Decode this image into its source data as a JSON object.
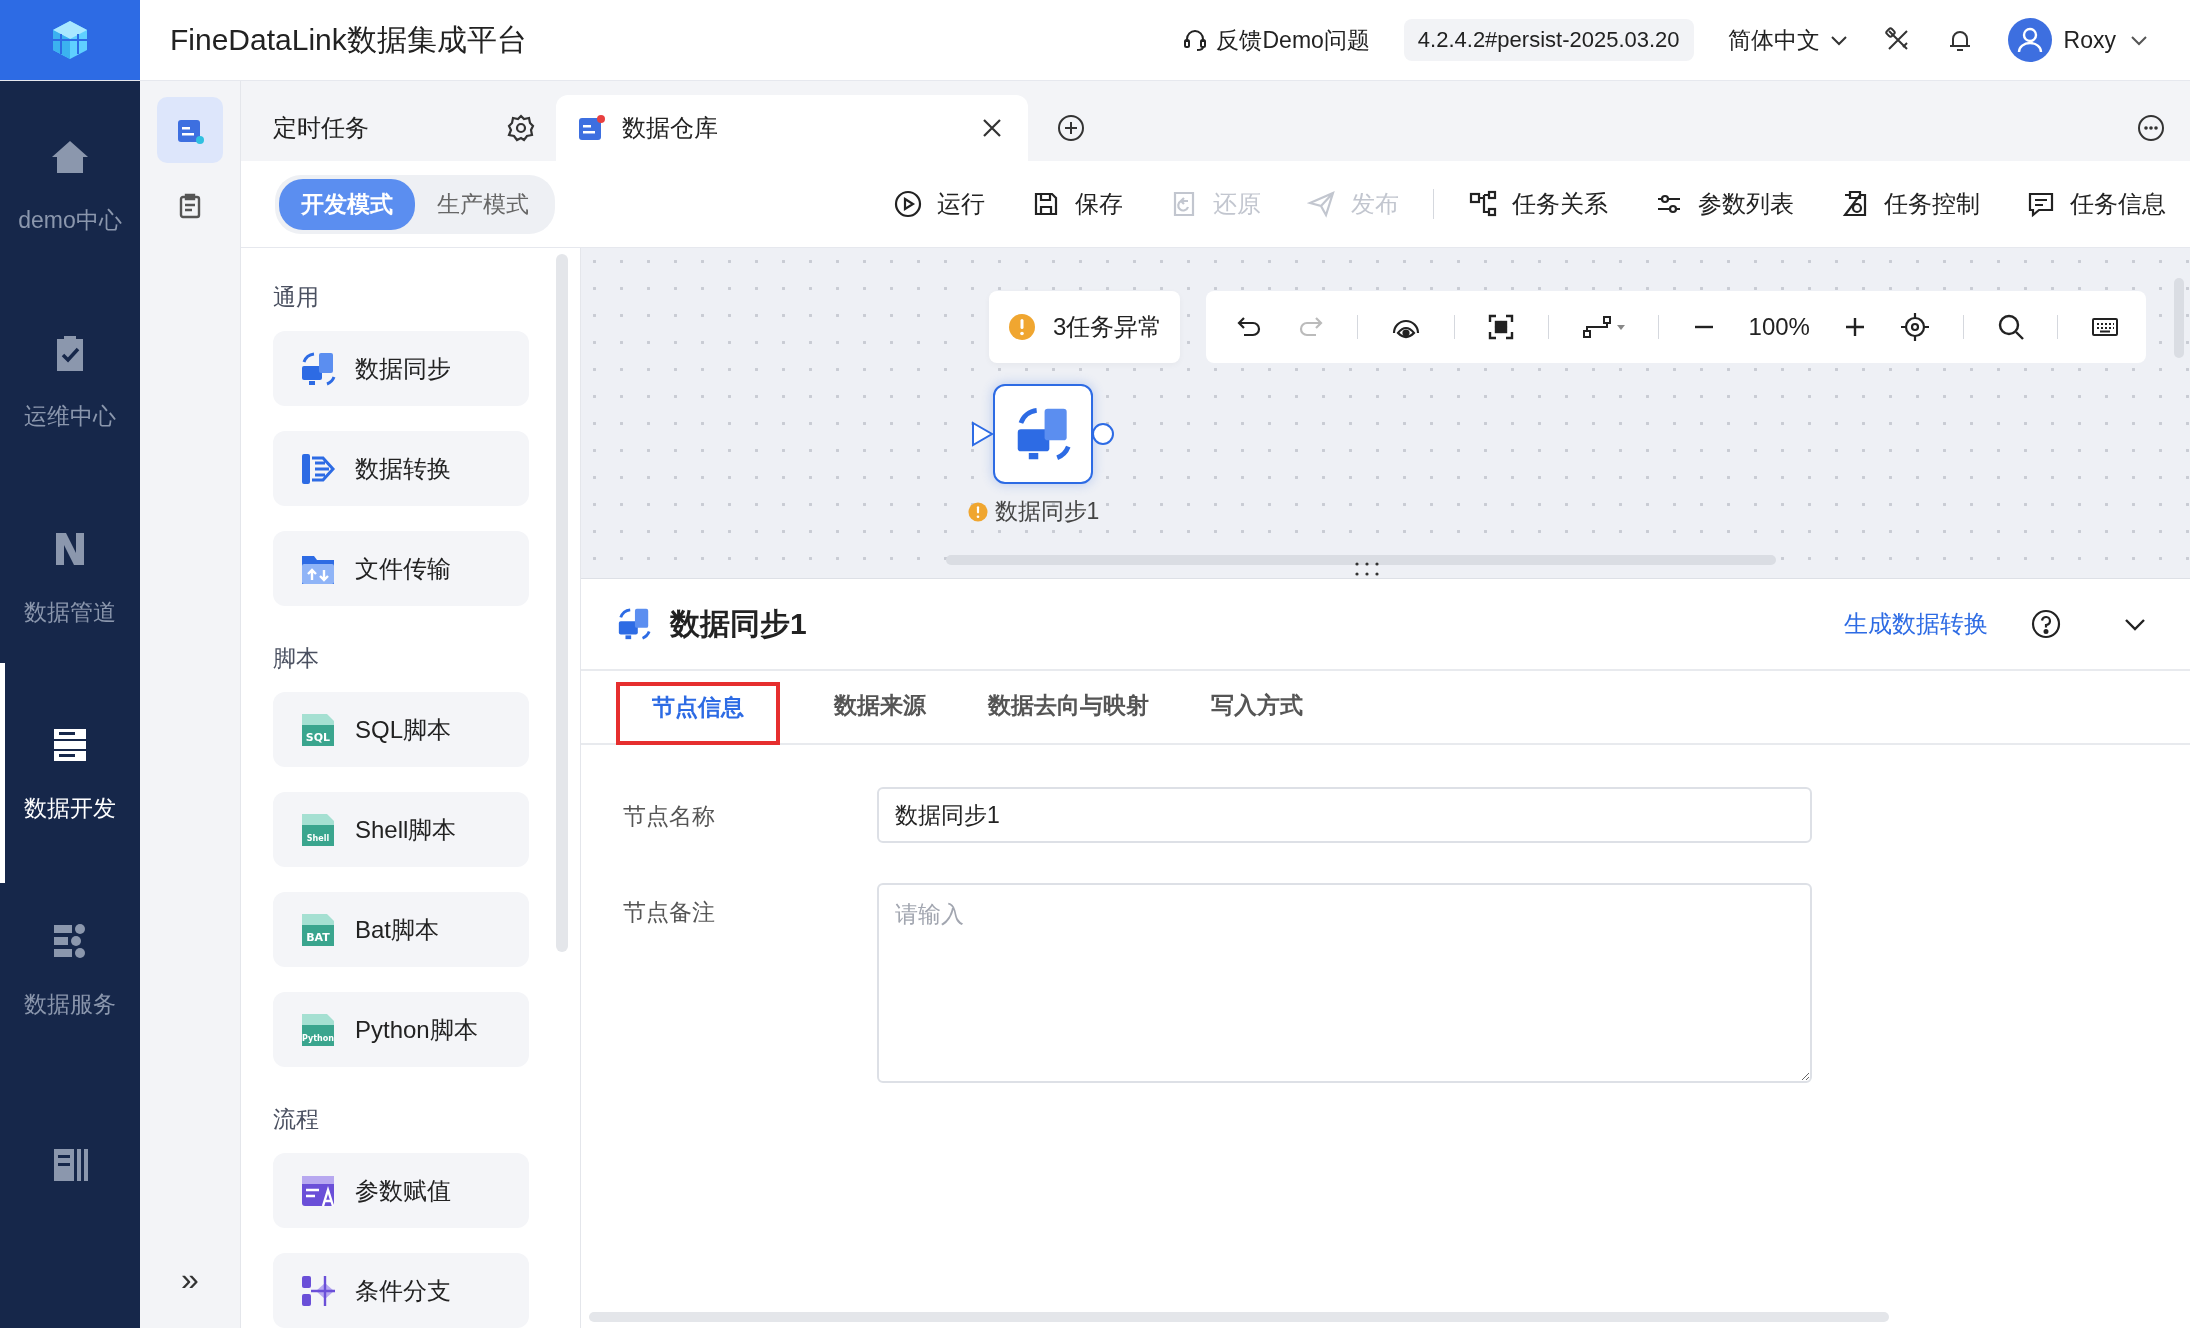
{
  "header": {
    "title": "FineDataLink数据集成平台",
    "feedback": "反馈Demo问题",
    "version": "4.2.4.2#persist-2025.03.20",
    "language": "简体中文",
    "user": "Roxy"
  },
  "nav": [
    {
      "label": "demo中心",
      "selected": false
    },
    {
      "label": "运维中心",
      "selected": false
    },
    {
      "label": "数据管道",
      "selected": false
    },
    {
      "label": "数据开发",
      "selected": true
    },
    {
      "label": "数据服务",
      "selected": false
    },
    {
      "selected": false
    }
  ],
  "subnav": [
    {
      "selected": true
    },
    {
      "selected": false
    }
  ],
  "subnav_toggle": "»",
  "tabs": [
    {
      "label": "定时任务",
      "selected": false
    },
    {
      "label": "数据仓库",
      "selected": true
    }
  ],
  "modes": [
    {
      "label": "开发模式",
      "selected": true
    },
    {
      "label": "生产模式",
      "selected": false
    }
  ],
  "actions": [
    {
      "label": "运行",
      "disabled": false
    },
    {
      "label": "保存",
      "disabled": false
    },
    {
      "label": "还原",
      "disabled": true
    },
    {
      "label": "发布",
      "disabled": true
    },
    {
      "label": "任务关系",
      "disabled": false
    },
    {
      "label": "参数列表",
      "disabled": false
    },
    {
      "label": "任务控制",
      "disabled": false
    },
    {
      "label": "任务信息",
      "disabled": false
    }
  ],
  "palette": [
    {
      "title": "通用",
      "items": [
        {
          "label": "数据同步"
        },
        {
          "label": "数据转换"
        },
        {
          "label": "文件传输"
        }
      ]
    },
    {
      "title": "脚本",
      "items": [
        {
          "label": "SQL脚本",
          "badge": "SQL"
        },
        {
          "label": "Shell脚本",
          "badge": "Shell"
        },
        {
          "label": "Bat脚本",
          "badge": "BAT"
        },
        {
          "label": "Python脚本",
          "badge": "Python"
        }
      ]
    },
    {
      "title": "流程",
      "items": [
        {
          "label": "参数赋值"
        },
        {
          "label": "条件分支"
        }
      ]
    }
  ],
  "canvas": {
    "warning": "3任务异常",
    "zoom": "100%",
    "node": {
      "label": "数据同步1",
      "warning": true
    }
  },
  "detail": {
    "title": "数据同步1",
    "link": "生成数据转换",
    "tabs": [
      {
        "label": "节点信息",
        "selected": true,
        "highlighted": true
      },
      {
        "label": "数据来源",
        "selected": false,
        "highlighted": false
      },
      {
        "label": "数据去向与映射",
        "selected": false,
        "highlighted": false
      },
      {
        "label": "写入方式",
        "selected": false,
        "highlighted": false
      }
    ],
    "fields": [
      {
        "label": "节点名称",
        "kind": "input",
        "value": "数据同步1"
      },
      {
        "label": "节点备注",
        "kind": "textarea",
        "placeholder": "请输入"
      }
    ]
  }
}
